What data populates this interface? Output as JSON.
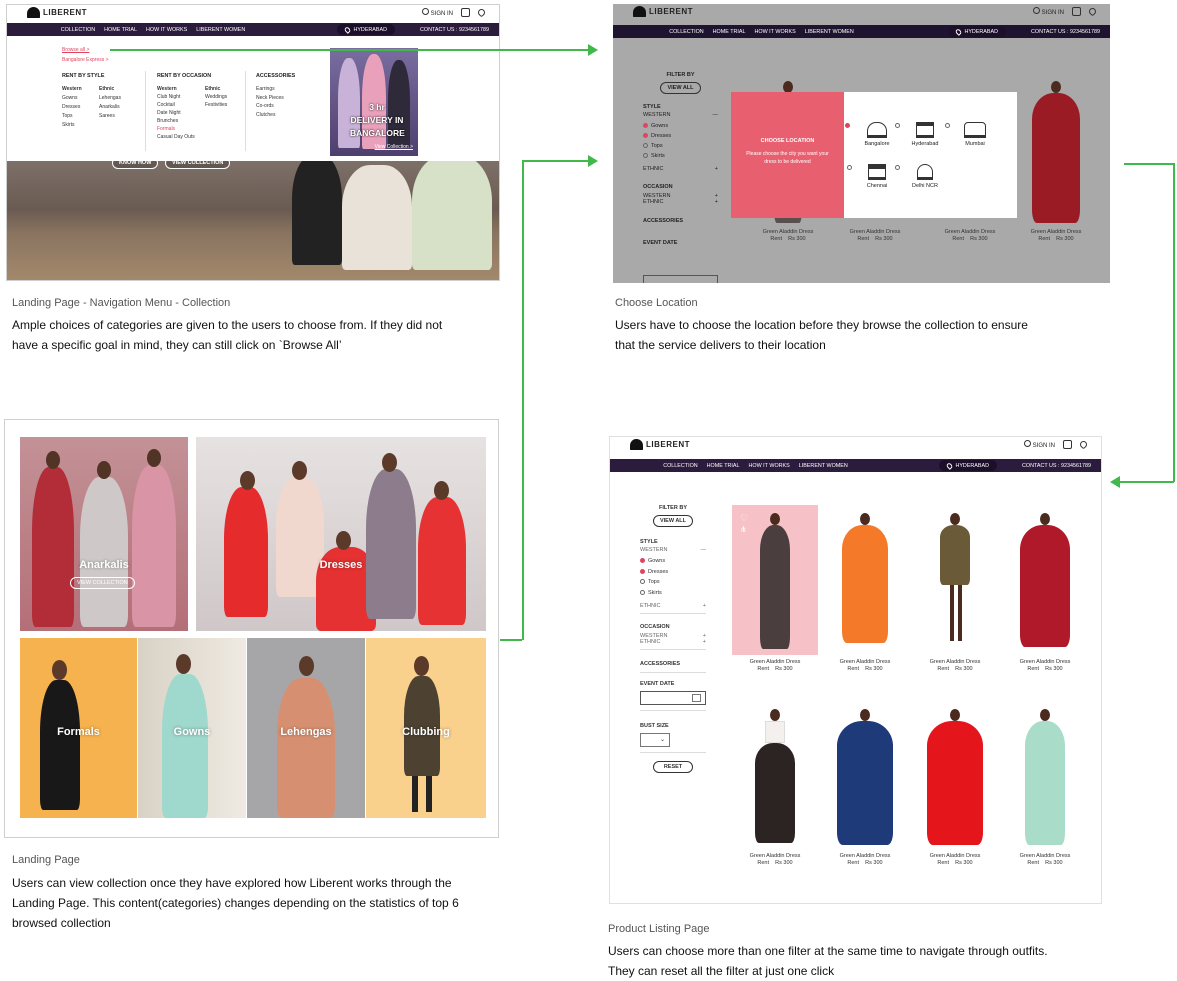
{
  "brand": "LIBERENT",
  "header": {
    "sign_in": "SIGN IN",
    "nav": [
      "COLLECTION",
      "HOME TRIAL",
      "HOW IT WORKS",
      "LIBERENT WOMEN"
    ],
    "city": "HYDERABAD",
    "contact": "CONTACT US : 9234561789"
  },
  "menu": {
    "browse_all": "Browse all >",
    "bangalore_express": "Bangalore Express >",
    "rent_by_style": "RENT BY STYLE",
    "western_title": "Western",
    "western": [
      "Gowns",
      "Dresses",
      "Tops",
      "Skirts"
    ],
    "ethnic_title": "Ethnic",
    "ethnic": [
      "Lehengas",
      "Anarkalis",
      "Sarees"
    ],
    "rent_by_occasion": "RENT BY OCCASION",
    "occ_western_title": "Western",
    "occ_western": [
      "Club Night",
      "Cocktail",
      "Date Night",
      "Brunches",
      "Formals",
      "Casual Day Outs"
    ],
    "occ_ethnic_title": "Ethnic",
    "occ_ethnic": [
      "Weddings",
      "Festivities"
    ],
    "accessories": "ACCESSORIES",
    "acc_items": [
      "Earrings",
      "Neck Pieces",
      "Co-ords",
      "Clutches"
    ],
    "promo": "3 hr DELIVERY IN BANGALORE",
    "promo_link": "View Collection >",
    "know_how": "KNOW HOW",
    "view_collection": "VIEW COLLECTION"
  },
  "captions": {
    "nav": {
      "title": "Landing Page - Navigation Menu - Collection",
      "text": "Ample choices of categories are given to the users to choose from. If they did not have a specific goal in mind, they can still click on `Browse All’"
    },
    "location": {
      "title": "Choose Location",
      "text": "Users have to choose the location before they browse the collection to ensure that the service delivers to their location"
    },
    "landing": {
      "title": "Landing Page",
      "text": "Users can view collection once they have explored how Liberent works through the Landing Page. This content(categories) changes depending on the statistics of top 6 browsed collection"
    },
    "listing": {
      "title": "Product Listing Page",
      "text": "Users can choose more than one filter at the same time to navigate through outfits. They can reset all the filter at just one click"
    }
  },
  "filters": {
    "filter_by": "FILTER BY",
    "view_all": "VIEW ALL",
    "style": "STYLE",
    "western": "WESTERN",
    "style_items": [
      "Gowns",
      "Dresses",
      "Tops",
      "Skirts"
    ],
    "ethnic": "ETHNIC",
    "occasion": "OCCASION",
    "occ_items": [
      "WESTERN",
      "ETHNIC"
    ],
    "accessories": "ACCESSORIES",
    "event_date": "EVENT DATE",
    "bust_size": "BUST SIZE",
    "reset": "RESET"
  },
  "location_modal": {
    "title": "CHOOSE LOCATION",
    "subtitle": "Please choose the city you want your dress to be delivered",
    "cities": [
      "Bangalore",
      "Hyderabad",
      "Mumbai",
      "Chennai",
      "Delhi NCR"
    ]
  },
  "categories": [
    {
      "label": "Anarkalis",
      "button": "VIEW COLLECTION"
    },
    {
      "label": "Dresses"
    },
    {
      "label": "Formals"
    },
    {
      "label": "Gowns"
    },
    {
      "label": "Lehengas"
    },
    {
      "label": "Clubbing"
    }
  ],
  "product": {
    "name": "Green Aladdin Dress",
    "rent": "Rent",
    "price": "Rs 300"
  },
  "colors": {
    "nav": "#2b1b3d",
    "accent": "#e0455f",
    "arrow": "#41b94a"
  }
}
